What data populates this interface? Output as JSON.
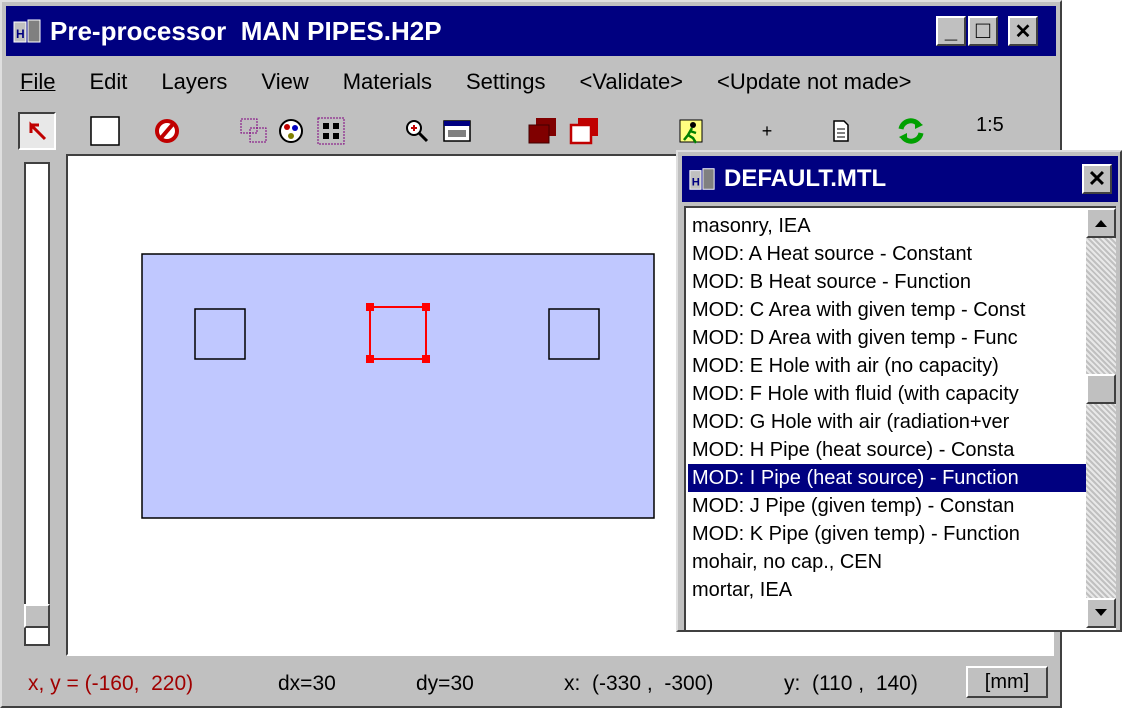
{
  "main_window": {
    "title": "Pre-processor  MAN PIPES.H2P",
    "minimize": "_",
    "maximize": "□",
    "close": "✕"
  },
  "menu": [
    "File",
    "Edit",
    "Layers",
    "View",
    "Materials",
    "Settings",
    "<Validate>",
    "<Update not made>"
  ],
  "toolbar": {
    "icons": [
      "select-arrow-icon",
      "rectangle-icon",
      "no-symbol-icon",
      "layers-icon",
      "palette-icon",
      "grid-points-icon",
      "zoom-in-icon",
      "zoom-window-icon",
      "bring-front-icon",
      "send-back-icon",
      "run-icon",
      "add-point-icon",
      "document-icon",
      "refresh-icon"
    ],
    "plus": "+",
    "zoom_level": "1:5"
  },
  "statusbar": {
    "cursor": "x, y = (-160,  220)",
    "dx": "dx=30",
    "dy": "dy=30",
    "x_range": "x:  (-330 ,  -300)",
    "y_range": "y:  (110 ,  140)",
    "unit": "[mm]"
  },
  "materials_popup": {
    "title": "DEFAULT.MTL",
    "close": "✕",
    "items": [
      "masonry, IEA",
      "MOD: A Heat source - Constant",
      "MOD: B Heat source - Function",
      "MOD: C Area with given temp - Const",
      "MOD: D Area with given temp - Func",
      "MOD: E Hole with air (no capacity)",
      "MOD: F Hole with fluid (with capacity",
      "MOD: G Hole with air (radiation+ver",
      "MOD: H Pipe (heat source) - Consta",
      "MOD: I Pipe (heat source) - Function",
      "MOD: J Pipe (given temp) - Constan",
      "MOD: K Pipe (given temp) - Function",
      "mohair, no cap., CEN",
      "mortar, IEA"
    ],
    "selected_index": 9
  },
  "colors": {
    "title_bg": "#000080",
    "region_fill": "#c0c8ff",
    "selection": "#ff0000",
    "status_text_red": "#a00000"
  }
}
